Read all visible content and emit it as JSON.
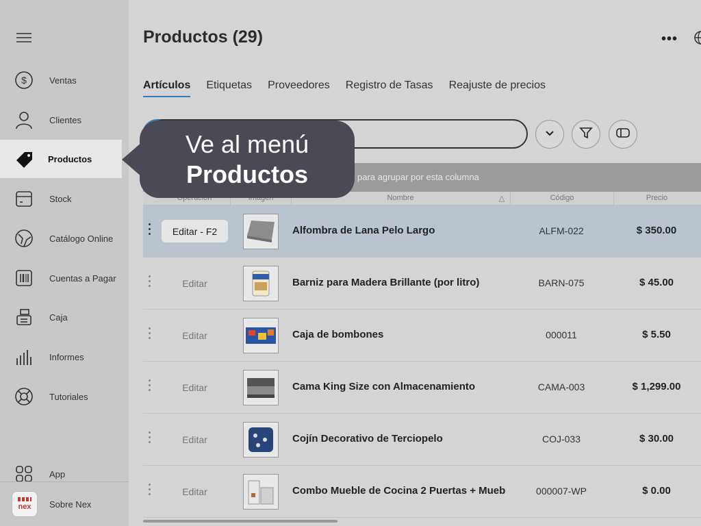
{
  "sidebar": {
    "items": [
      {
        "label": "Ventas",
        "icon": "dollar-circle-icon"
      },
      {
        "label": "Clientes",
        "icon": "user-icon"
      },
      {
        "label": "Productos",
        "icon": "tag-icon",
        "active": true
      },
      {
        "label": "Stock",
        "icon": "box-icon"
      },
      {
        "label": "Catálogo Online",
        "icon": "globe-leaf-icon"
      },
      {
        "label": "Cuentas a Pagar",
        "icon": "barcode-icon"
      },
      {
        "label": "Caja",
        "icon": "cash-register-icon"
      },
      {
        "label": "Informes",
        "icon": "bar-chart-icon"
      },
      {
        "label": "Tutoriales",
        "icon": "lifebuoy-icon"
      },
      {
        "label": "App",
        "icon": "apps-grid-icon"
      },
      {
        "label": "Sobre Nex",
        "icon": "nex-logo"
      }
    ],
    "logo_text": "nex"
  },
  "header": {
    "title": "Productos (29)"
  },
  "tabs": [
    "Artículos",
    "Etiquetas",
    "Proveedores",
    "Registro de Tasas",
    "Reajuste de precios"
  ],
  "group_bar_text": "para agrupar por esta columna",
  "columns": [
    "Operación",
    "Imagen",
    "Nombre",
    "Código",
    "Precio"
  ],
  "rows": [
    {
      "edit": "Editar - F2",
      "name": "Alfombra de Lana Pelo Largo",
      "code": "ALFM-022",
      "price": "$ 350.00",
      "selected": true
    },
    {
      "edit": "Editar",
      "name": "Barniz para Madera Brillante (por litro)",
      "code": "BARN-075",
      "price": "$ 45.00"
    },
    {
      "edit": "Editar",
      "name": "Caja de bombones",
      "code": "000011",
      "price": "$ 5.50"
    },
    {
      "edit": "Editar",
      "name": "Cama King Size con Almacenamiento",
      "code": "CAMA-003",
      "price": "$ 1,299.00"
    },
    {
      "edit": "Editar",
      "name": "Cojín Decorativo de Terciopelo",
      "code": "COJ-033",
      "price": "$ 30.00"
    },
    {
      "edit": "Editar",
      "name": "Combo Mueble de Cocina 2 Puertas + Mueb",
      "code": "000007-WP",
      "price": "$ 0.00"
    }
  ],
  "callout": {
    "line1": "Ve al menú",
    "line2": "Productos"
  },
  "colors": {
    "accent": "#2e7bbd",
    "callout_bg": "#4a4a55",
    "selected_row": "#b9c4cf"
  }
}
